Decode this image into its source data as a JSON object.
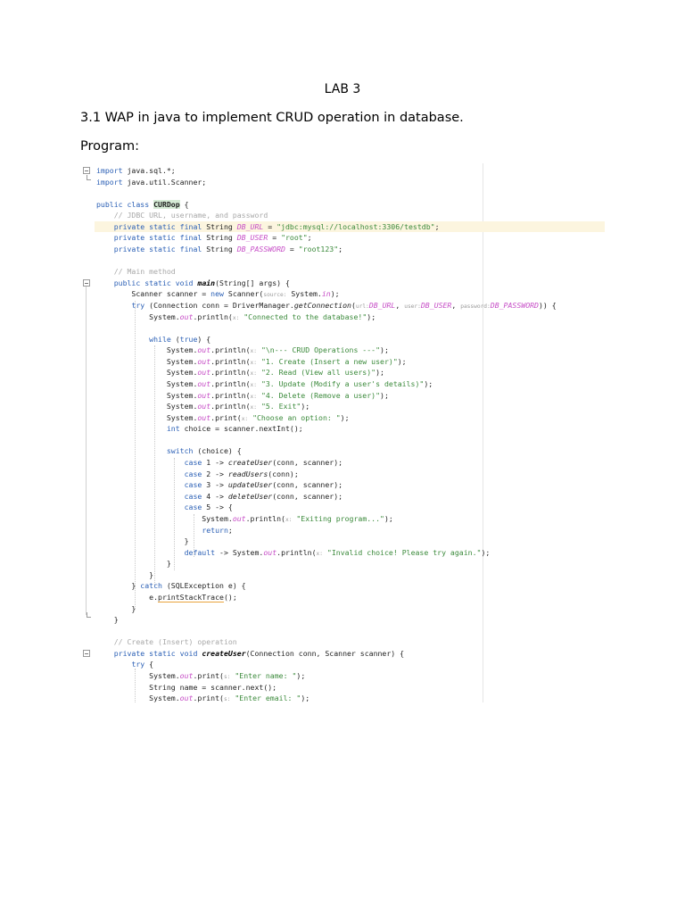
{
  "document": {
    "title": "LAB 3",
    "question": "3.1 WAP in java to implement CRUD operation in database.",
    "program_label": "Program:"
  },
  "code_lines": [
    [
      {
        "t": "import",
        "c": "kw"
      },
      {
        "t": " java.sql.*;"
      }
    ],
    [
      {
        "t": "import",
        "c": "kw"
      },
      {
        "t": " java.util.Scanner;"
      }
    ],
    [
      {
        "t": ""
      }
    ],
    [
      {
        "t": "public class",
        "c": "kw"
      },
      {
        "t": " "
      },
      {
        "t": "CURDop",
        "c": "cls-hl"
      },
      {
        "t": " {"
      }
    ],
    [
      {
        "t": "    "
      },
      {
        "t": "// JDBC URL, username, and password",
        "c": "cmt"
      }
    ],
    [
      {
        "t": "    "
      },
      {
        "t": "private static final",
        "c": "kw"
      },
      {
        "t": " String "
      },
      {
        "t": "DB_URL",
        "c": "sfld"
      },
      {
        "t": " = "
      },
      {
        "t": "\"jdbc:mysql://localhost:3306/testdb\"",
        "c": "str"
      },
      {
        "t": ";"
      }
    ],
    [
      {
        "t": "    "
      },
      {
        "t": "private static final",
        "c": "kw"
      },
      {
        "t": " String "
      },
      {
        "t": "DB_USER",
        "c": "sfld"
      },
      {
        "t": " = "
      },
      {
        "t": "\"root\"",
        "c": "str"
      },
      {
        "t": ";"
      }
    ],
    [
      {
        "t": "    "
      },
      {
        "t": "private static final",
        "c": "kw"
      },
      {
        "t": " String "
      },
      {
        "t": "DB_PASSWORD",
        "c": "sfld"
      },
      {
        "t": " = "
      },
      {
        "t": "\"root123\"",
        "c": "str"
      },
      {
        "t": ";"
      }
    ],
    [
      {
        "t": ""
      }
    ],
    [
      {
        "t": "    "
      },
      {
        "t": "// Main method",
        "c": "cmt"
      }
    ],
    [
      {
        "t": "    "
      },
      {
        "t": "public static void",
        "c": "kw"
      },
      {
        "t": " "
      },
      {
        "t": "main",
        "c": "m-bold"
      },
      {
        "t": "(String[] args) {"
      }
    ],
    [
      {
        "t": "        Scanner scanner = "
      },
      {
        "t": "new",
        "c": "kw"
      },
      {
        "t": " Scanner("
      },
      {
        "t": "source:",
        "c": "hint"
      },
      {
        "t": " System."
      },
      {
        "t": "in",
        "c": "fld"
      },
      {
        "t": ");"
      }
    ],
    [
      {
        "t": "        "
      },
      {
        "t": "try",
        "c": "kw"
      },
      {
        "t": " (Connection conn = DriverManager."
      },
      {
        "t": "getConnection",
        "c": "m-it"
      },
      {
        "t": "("
      },
      {
        "t": "url:",
        "c": "hint"
      },
      {
        "t": "DB_URL",
        "c": "sfld"
      },
      {
        "t": ", "
      },
      {
        "t": "user:",
        "c": "hint"
      },
      {
        "t": "DB_USER",
        "c": "sfld"
      },
      {
        "t": ", "
      },
      {
        "t": "password:",
        "c": "hint"
      },
      {
        "t": "DB_PASSWORD",
        "c": "sfld"
      },
      {
        "t": ")) {"
      }
    ],
    [
      {
        "t": "            System."
      },
      {
        "t": "out",
        "c": "fld"
      },
      {
        "t": ".println("
      },
      {
        "t": "x:",
        "c": "hint"
      },
      {
        "t": " "
      },
      {
        "t": "\"Connected to the database!\"",
        "c": "str"
      },
      {
        "t": ");"
      }
    ],
    [
      {
        "t": ""
      }
    ],
    [
      {
        "t": "            "
      },
      {
        "t": "while",
        "c": "kw"
      },
      {
        "t": " ("
      },
      {
        "t": "true",
        "c": "kw"
      },
      {
        "t": ") {"
      }
    ],
    [
      {
        "t": "                System."
      },
      {
        "t": "out",
        "c": "fld"
      },
      {
        "t": ".println("
      },
      {
        "t": "x:",
        "c": "hint"
      },
      {
        "t": " "
      },
      {
        "t": "\"\\n--- CRUD Operations ---\"",
        "c": "str"
      },
      {
        "t": ");"
      }
    ],
    [
      {
        "t": "                System."
      },
      {
        "t": "out",
        "c": "fld"
      },
      {
        "t": ".println("
      },
      {
        "t": "x:",
        "c": "hint"
      },
      {
        "t": " "
      },
      {
        "t": "\"1. Create (Insert a new user)\"",
        "c": "str"
      },
      {
        "t": ");"
      }
    ],
    [
      {
        "t": "                System."
      },
      {
        "t": "out",
        "c": "fld"
      },
      {
        "t": ".println("
      },
      {
        "t": "x:",
        "c": "hint"
      },
      {
        "t": " "
      },
      {
        "t": "\"2. Read (View all users)\"",
        "c": "str"
      },
      {
        "t": ");"
      }
    ],
    [
      {
        "t": "                System."
      },
      {
        "t": "out",
        "c": "fld"
      },
      {
        "t": ".println("
      },
      {
        "t": "x:",
        "c": "hint"
      },
      {
        "t": " "
      },
      {
        "t": "\"3. Update (Modify a user's details)\"",
        "c": "str"
      },
      {
        "t": ");"
      }
    ],
    [
      {
        "t": "                System."
      },
      {
        "t": "out",
        "c": "fld"
      },
      {
        "t": ".println("
      },
      {
        "t": "x:",
        "c": "hint"
      },
      {
        "t": " "
      },
      {
        "t": "\"4. Delete (Remove a user)\"",
        "c": "str"
      },
      {
        "t": ");"
      }
    ],
    [
      {
        "t": "                System."
      },
      {
        "t": "out",
        "c": "fld"
      },
      {
        "t": ".println("
      },
      {
        "t": "x:",
        "c": "hint"
      },
      {
        "t": " "
      },
      {
        "t": "\"5. Exit\"",
        "c": "str"
      },
      {
        "t": ");"
      }
    ],
    [
      {
        "t": "                System."
      },
      {
        "t": "out",
        "c": "fld"
      },
      {
        "t": ".print("
      },
      {
        "t": "x:",
        "c": "hint"
      },
      {
        "t": " "
      },
      {
        "t": "\"Choose an option: \"",
        "c": "str"
      },
      {
        "t": ");"
      }
    ],
    [
      {
        "t": "                "
      },
      {
        "t": "int",
        "c": "kw"
      },
      {
        "t": " choice = scanner.nextInt();"
      }
    ],
    [
      {
        "t": ""
      }
    ],
    [
      {
        "t": "                "
      },
      {
        "t": "switch",
        "c": "kw"
      },
      {
        "t": " (choice) {"
      }
    ],
    [
      {
        "t": "                    "
      },
      {
        "t": "case",
        "c": "kw"
      },
      {
        "t": " 1 -> "
      },
      {
        "t": "createUser",
        "c": "m-it"
      },
      {
        "t": "(conn, scanner);"
      }
    ],
    [
      {
        "t": "                    "
      },
      {
        "t": "case",
        "c": "kw"
      },
      {
        "t": " 2 -> "
      },
      {
        "t": "readUsers",
        "c": "m-it"
      },
      {
        "t": "(conn);"
      }
    ],
    [
      {
        "t": "                    "
      },
      {
        "t": "case",
        "c": "kw"
      },
      {
        "t": " 3 -> "
      },
      {
        "t": "updateUser",
        "c": "m-it"
      },
      {
        "t": "(conn, scanner);"
      }
    ],
    [
      {
        "t": "                    "
      },
      {
        "t": "case",
        "c": "kw"
      },
      {
        "t": " 4 -> "
      },
      {
        "t": "deleteUser",
        "c": "m-it"
      },
      {
        "t": "(conn, scanner);"
      }
    ],
    [
      {
        "t": "                    "
      },
      {
        "t": "case",
        "c": "kw"
      },
      {
        "t": " 5 -> {"
      }
    ],
    [
      {
        "t": "                        System."
      },
      {
        "t": "out",
        "c": "fld"
      },
      {
        "t": ".println("
      },
      {
        "t": "x:",
        "c": "hint"
      },
      {
        "t": " "
      },
      {
        "t": "\"Exiting program...\"",
        "c": "str"
      },
      {
        "t": ");"
      }
    ],
    [
      {
        "t": "                        "
      },
      {
        "t": "return",
        "c": "kw"
      },
      {
        "t": ";"
      }
    ],
    [
      {
        "t": "                    }"
      }
    ],
    [
      {
        "t": "                    "
      },
      {
        "t": "default",
        "c": "kw"
      },
      {
        "t": " -> System."
      },
      {
        "t": "out",
        "c": "fld"
      },
      {
        "t": ".println("
      },
      {
        "t": "x:",
        "c": "hint"
      },
      {
        "t": " "
      },
      {
        "t": "\"Invalid choice! Please try again.\"",
        "c": "str"
      },
      {
        "t": ");"
      }
    ],
    [
      {
        "t": "                }"
      }
    ],
    [
      {
        "t": "            }"
      }
    ],
    [
      {
        "t": "        } "
      },
      {
        "t": "catch",
        "c": "kw"
      },
      {
        "t": " (SQLException e) {"
      }
    ],
    [
      {
        "t": "            e."
      },
      {
        "t": "printStackTrace",
        "c": "warn"
      },
      {
        "t": "();"
      }
    ],
    [
      {
        "t": "        }"
      }
    ],
    [
      {
        "t": "    }"
      }
    ],
    [
      {
        "t": ""
      }
    ],
    [
      {
        "t": "    "
      },
      {
        "t": "// Create (Insert) operation",
        "c": "cmt"
      }
    ],
    [
      {
        "t": "    "
      },
      {
        "t": "private static void",
        "c": "kw"
      },
      {
        "t": " "
      },
      {
        "t": "createUser",
        "c": "m-bold"
      },
      {
        "t": "(Connection conn, Scanner scanner) {"
      }
    ],
    [
      {
        "t": "        "
      },
      {
        "t": "try",
        "c": "kw"
      },
      {
        "t": " {"
      }
    ],
    [
      {
        "t": "            System."
      },
      {
        "t": "out",
        "c": "fld"
      },
      {
        "t": ".print("
      },
      {
        "t": "s:",
        "c": "hint"
      },
      {
        "t": " "
      },
      {
        "t": "\"Enter name: \"",
        "c": "str"
      },
      {
        "t": ");"
      }
    ],
    [
      {
        "t": "            String name = scanner.next();"
      }
    ],
    [
      {
        "t": "            System."
      },
      {
        "t": "out",
        "c": "fld"
      },
      {
        "t": ".print("
      },
      {
        "t": "s:",
        "c": "hint"
      },
      {
        "t": " "
      },
      {
        "t": "\"Enter email: \"",
        "c": "str"
      },
      {
        "t": ");"
      }
    ]
  ]
}
